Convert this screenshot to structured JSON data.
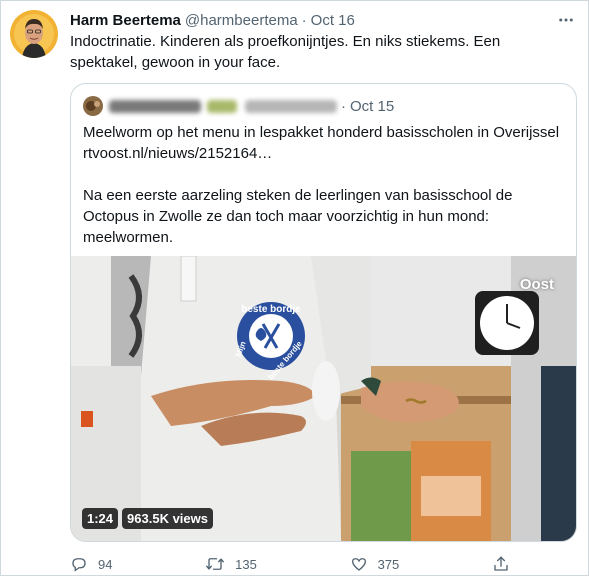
{
  "tweet": {
    "author_name": "Harm Beertema",
    "author_handle": "@harmbeertema",
    "separator": "·",
    "timestamp": "Oct 16",
    "text": "Indoctrinatie. Kinderen als proefkonijntjes. En niks stiekems. Een spektakel, gewoon in your face."
  },
  "quoted": {
    "separator": "·",
    "timestamp": "Oct 15",
    "text": "Meelworm op het menu in lespakket honderd basisscholen in Overijssel\nrtvoost.nl/nieuws/2152164…\n\nNa een eerste aarzeling steken de leerlingen van basisschool de Octopus in Zwolle ze dan toch maar voorzichtig in hun mond: meelwormen.",
    "media": {
      "watermark": "Oost",
      "duration": "1:24",
      "views": "963.5K views",
      "apron_logo_top": "beste bordje",
      "apron_logo_side": "Mijn",
      "apron_logo_bottom": "beste bordje"
    }
  },
  "actions": {
    "replies": "94",
    "retweets": "135",
    "likes": "375"
  },
  "icons": {
    "more": "more-icon",
    "reply": "reply-icon",
    "retweet": "retweet-icon",
    "like": "like-icon",
    "share": "share-icon"
  },
  "colors": {
    "text": "#0f1419",
    "secondary": "#536471",
    "border": "#cfd9de"
  }
}
